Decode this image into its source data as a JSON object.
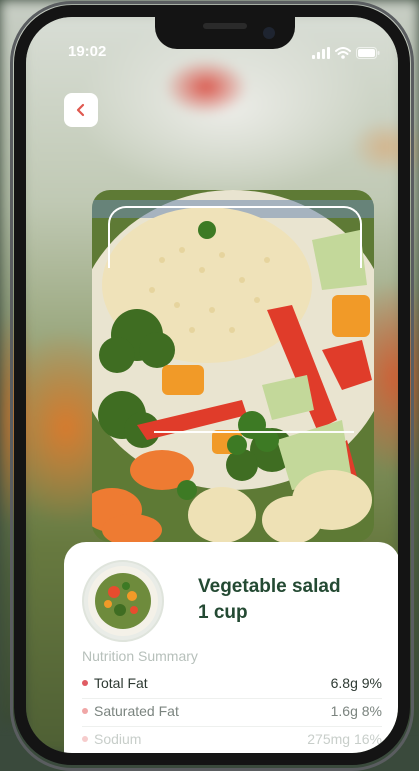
{
  "status_bar": {
    "time": "19:02"
  },
  "food": {
    "name": "Vegetable salad",
    "portion": "1 cup"
  },
  "nutrition": {
    "title": "Nutrition Summary",
    "rows": [
      {
        "name": "Total Fat",
        "amount": "6.8g",
        "percent": "9%",
        "dot": "#e05c63",
        "text_color": "#2e3a33"
      },
      {
        "name": "Saturated Fat",
        "amount": "1.6g",
        "percent": "8%",
        "dot": "#f0a6a6",
        "text_color": "#7b847f"
      },
      {
        "name": "Sodium",
        "amount": "275mg",
        "percent": "16%",
        "dot": "#f6cccc",
        "text_color": "#c8ceca"
      }
    ]
  },
  "colors": {
    "accent": "#e0584f",
    "heading": "#244a33"
  },
  "icons": {
    "back": "chevron-left-icon",
    "signal": "signal-icon",
    "wifi": "wifi-icon",
    "battery": "battery-icon"
  }
}
